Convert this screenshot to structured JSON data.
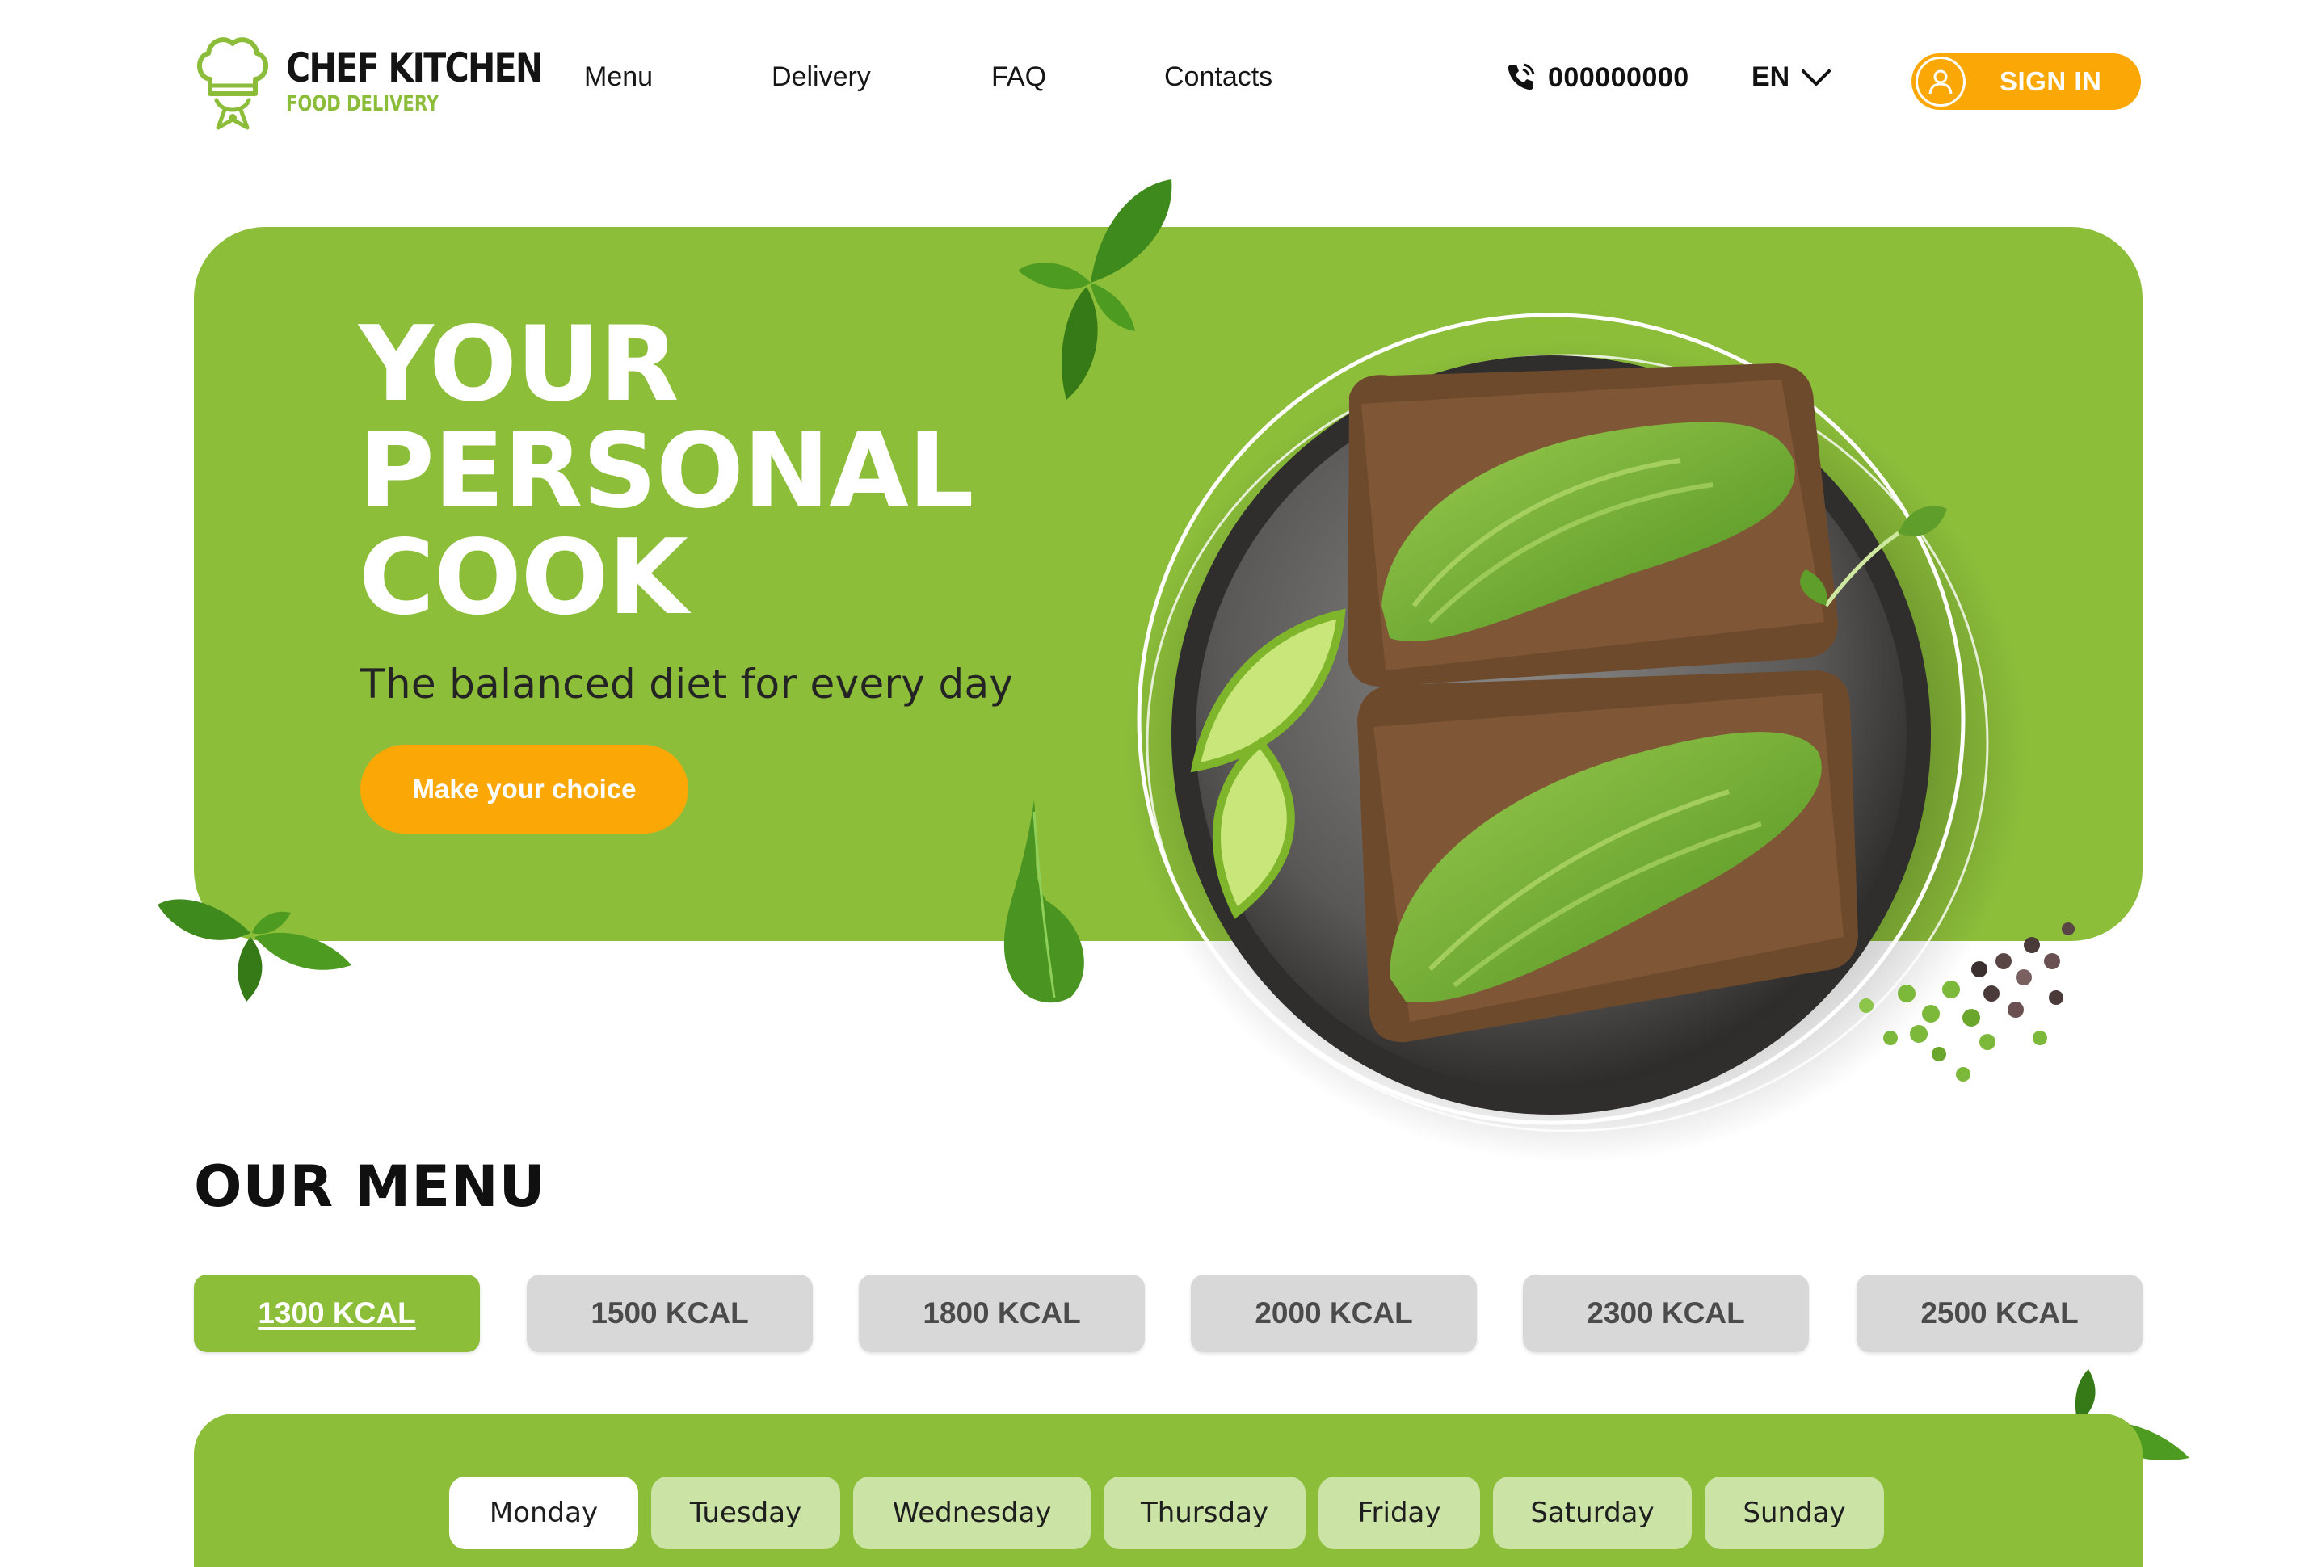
{
  "brand": {
    "name": "CHEF KITCHEN",
    "tagline": "FOOD DELIVERY",
    "logo_icon": "chef-hat-icon"
  },
  "nav": {
    "items": [
      {
        "label": "Menu"
      },
      {
        "label": "Delivery"
      },
      {
        "label": "FAQ"
      },
      {
        "label": "Contacts"
      }
    ]
  },
  "header": {
    "phone_icon": "phone-icon",
    "phone": "000000000",
    "language": "EN",
    "sign_in": "SIGN IN"
  },
  "hero": {
    "title_lines": [
      "YOUR",
      "PERSONAL",
      "COOK"
    ],
    "subtitle": "The balanced diet for every day",
    "cta": "Make your choice"
  },
  "menu": {
    "title": "OUR MENU",
    "kcal_options": [
      {
        "label": "1300 KCAL",
        "active": true
      },
      {
        "label": "1500 KCAL",
        "active": false
      },
      {
        "label": "1800 KCAL",
        "active": false
      },
      {
        "label": "2000 KCAL",
        "active": false
      },
      {
        "label": "2300 KCAL",
        "active": false
      },
      {
        "label": "2500 KCAL",
        "active": false
      }
    ],
    "days": [
      {
        "label": "Monday",
        "active": true
      },
      {
        "label": "Tuesday",
        "active": false
      },
      {
        "label": "Wednesday",
        "active": false
      },
      {
        "label": "Thursday",
        "active": false
      },
      {
        "label": "Friday",
        "active": false
      },
      {
        "label": "Saturday",
        "active": false
      },
      {
        "label": "Sunday",
        "active": false
      }
    ]
  },
  "colors": {
    "brand_green": "#8cbe3a",
    "accent_orange": "#fba706",
    "inactive_tab": "#d8d8d8",
    "day_tab": "#cbe4a5"
  }
}
